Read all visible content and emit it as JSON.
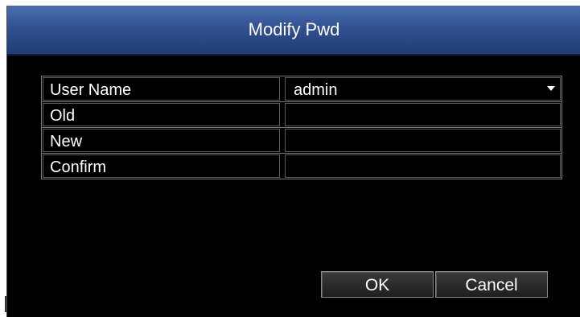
{
  "dialog": {
    "title": "Modify Pwd"
  },
  "form": {
    "rows": [
      {
        "label": "User Name",
        "value": "admin",
        "type": "select"
      },
      {
        "label": "Old",
        "value": "",
        "type": "password"
      },
      {
        "label": "New",
        "value": "",
        "type": "password"
      },
      {
        "label": "Confirm",
        "value": "",
        "type": "password"
      }
    ]
  },
  "buttons": {
    "ok_label": "OK",
    "cancel_label": "Cancel"
  },
  "colors": {
    "title_bar": "#2f4f8e",
    "background": "#000000",
    "text": "#ffffff",
    "border": "#7a7a7a"
  }
}
